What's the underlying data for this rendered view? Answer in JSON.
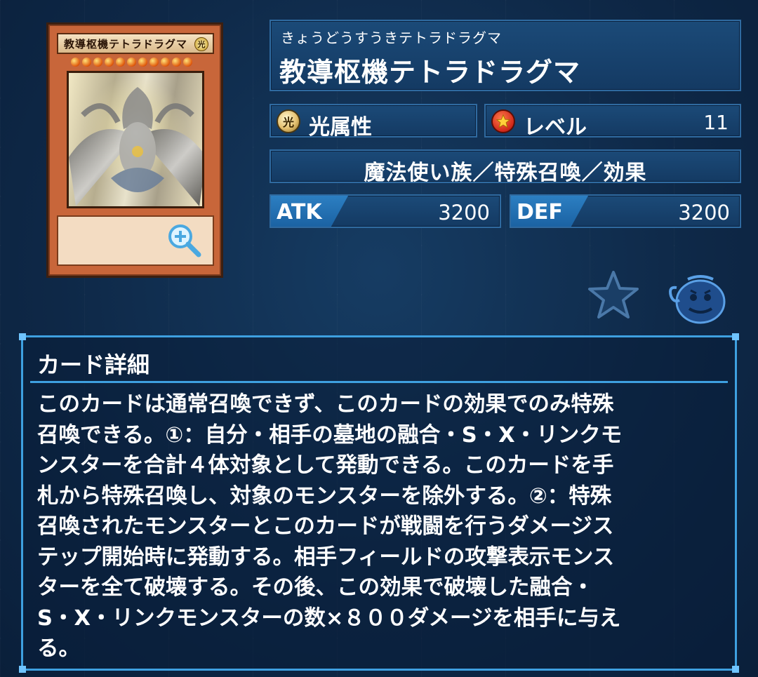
{
  "card_image": {
    "name_text": "教導枢機テトラドラグマ",
    "attribute_glyph": "光",
    "stars": 11,
    "zoom_icon": "zoom-in-icon"
  },
  "card": {
    "ruby": "きょうどうすうきテトラドラグマ",
    "name": "教導枢機テトラドラグマ",
    "attribute_icon_glyph": "光",
    "attribute": "光属性",
    "level_label": "レベル",
    "level": "11",
    "type": "魔法使い族／特殊召喚／効果",
    "atk_label": "ATK",
    "atk": "3200",
    "def_label": "DEF",
    "def": "3200"
  },
  "actions": {
    "favorite_icon": "star-icon",
    "pot_icon": "pot-of-greed-icon"
  },
  "detail": {
    "title": "カード詳細",
    "lines": [
      "このカードは通常召喚できず、このカードの効果でのみ特殊",
      "召喚できる。①：自分・相手の墓地の融合・S・X・リンクモ",
      "ンスターを合計４体対象として発動できる。このカードを手",
      "札から特殊召喚し、対象のモンスターを除外する。②：特殊",
      "召喚されたモンスターとこのカードが戦闘を行うダメージス",
      "テップ開始時に発動する。相手フィールドの攻撃表示モンス",
      "ターを全て破壊する。その後、この効果で破壊した融合・",
      "S・X・リンクモンスターの数×８００ダメージを相手に与え",
      "る。"
    ]
  },
  "colors": {
    "background": "#0f2a4a",
    "panel": "#1b4a78",
    "panel_border": "#2f6aa0",
    "accent": "#3ea0e0",
    "card_frame": "#c8663a"
  }
}
